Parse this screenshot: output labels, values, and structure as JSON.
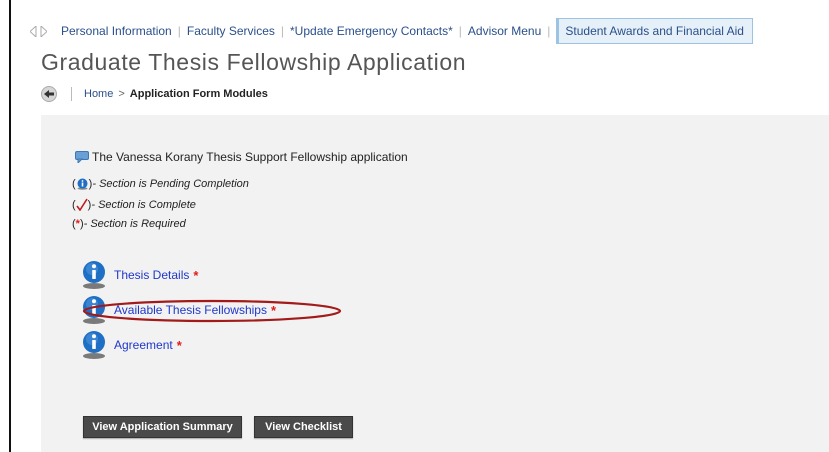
{
  "nav": {
    "items": [
      "Personal Information",
      "Faculty Services",
      "*Update Emergency Contacts*",
      "Advisor Menu"
    ],
    "active": "Student Awards and Financial Aid"
  },
  "page_title": "Graduate Thesis Fellowship Application",
  "breadcrumb": {
    "home": "Home",
    "separator": ">",
    "current": "Application Form Modules"
  },
  "application_heading": "The Vanessa Korany Thesis Support Fellowship application",
  "legend": {
    "pending": {
      "open": "(",
      "close": ")",
      "text": " - Section is Pending Completion"
    },
    "complete": {
      "open": "(",
      "close": ")",
      "text": " - Section is Complete"
    },
    "required": {
      "open": "(",
      "mark": "*",
      "close": ")",
      "text": " - Section is Required"
    }
  },
  "modules": [
    {
      "label": "Thesis Details",
      "required_mark": "*"
    },
    {
      "label": "Available Thesis Fellowships",
      "required_mark": "*"
    },
    {
      "label": "Agreement",
      "required_mark": "*"
    }
  ],
  "buttons": {
    "summary": "View Application Summary",
    "checklist": "View Checklist"
  },
  "colors": {
    "link": "#1f38c9",
    "required": "#e21b1b",
    "annotation": "#a31a1a",
    "panel": "#f2f2f2",
    "button": "#4a4a4a"
  }
}
